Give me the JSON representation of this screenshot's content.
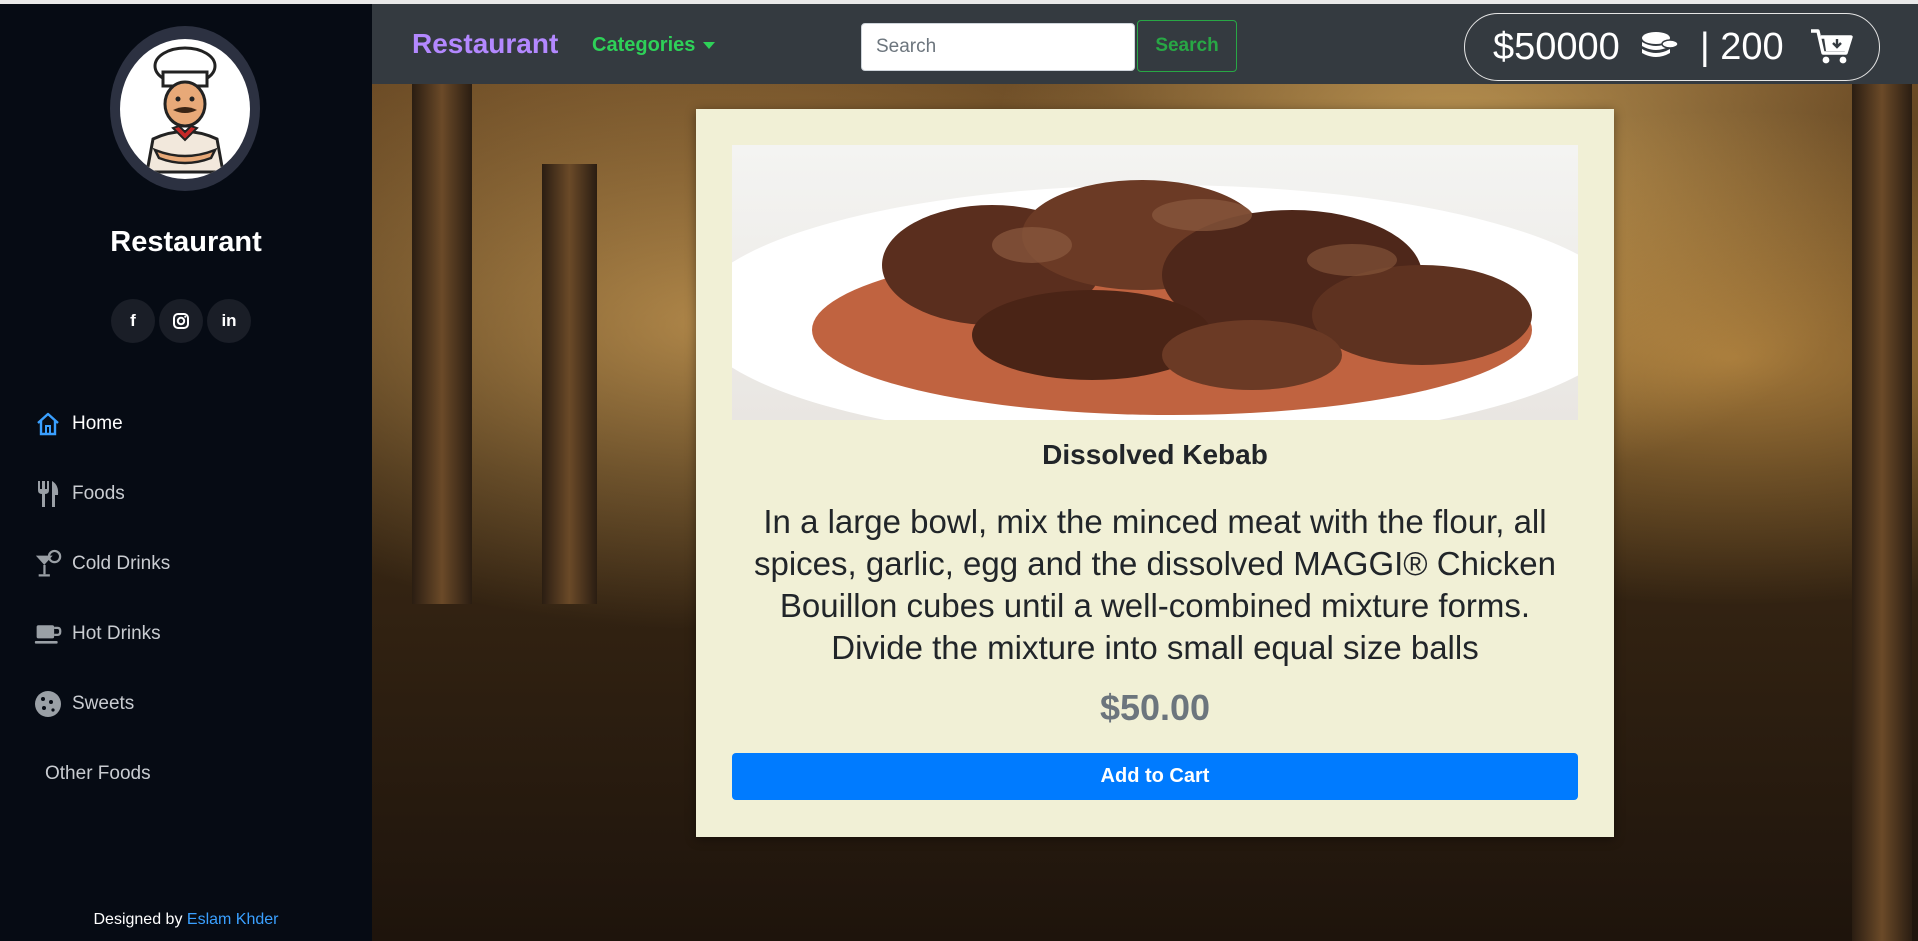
{
  "sidebar": {
    "brand": "Restaurant",
    "socials": [
      {
        "icon": "facebook-icon",
        "label": "f"
      },
      {
        "icon": "instagram-icon",
        "label": ""
      },
      {
        "icon": "linkedin-icon",
        "label": "in"
      }
    ],
    "items": [
      {
        "label": "Home",
        "icon": "home-icon",
        "active": true
      },
      {
        "label": "Foods",
        "icon": "utensils-icon"
      },
      {
        "label": "Cold Drinks",
        "icon": "cocktail-icon"
      },
      {
        "label": "Hot Drinks",
        "icon": "coffee-cup-icon"
      },
      {
        "label": "Sweets",
        "icon": "cookie-icon"
      },
      {
        "label": "Other Foods",
        "icon": ""
      }
    ],
    "footer_prefix": "Designed by ",
    "footer_author": "Eslam Khder"
  },
  "navbar": {
    "brand": "Restaurant",
    "categories_label": "Categories",
    "search_placeholder": "Search",
    "search_button": "Search",
    "balance": "$50000",
    "cart_separator": "| 200"
  },
  "card": {
    "title": "Dissolved Kebab",
    "description": "In a large bowl, mix the minced meat with the flour, all spices, garlic, egg and the dissolved MAGGI® Chicken Bouillon cubes until a well-combined mixture forms. Divide the mixture into small equal size balls",
    "price": "$50.00",
    "button": "Add to Cart"
  },
  "colors": {
    "sidebar_bg": "#060b14",
    "navbar_bg": "#343a40",
    "brand": "#b388ff",
    "categories": "#2ed158",
    "search_btn": "#28a745",
    "card_bg": "#f1f0d6",
    "cart_btn": "#007bff"
  }
}
